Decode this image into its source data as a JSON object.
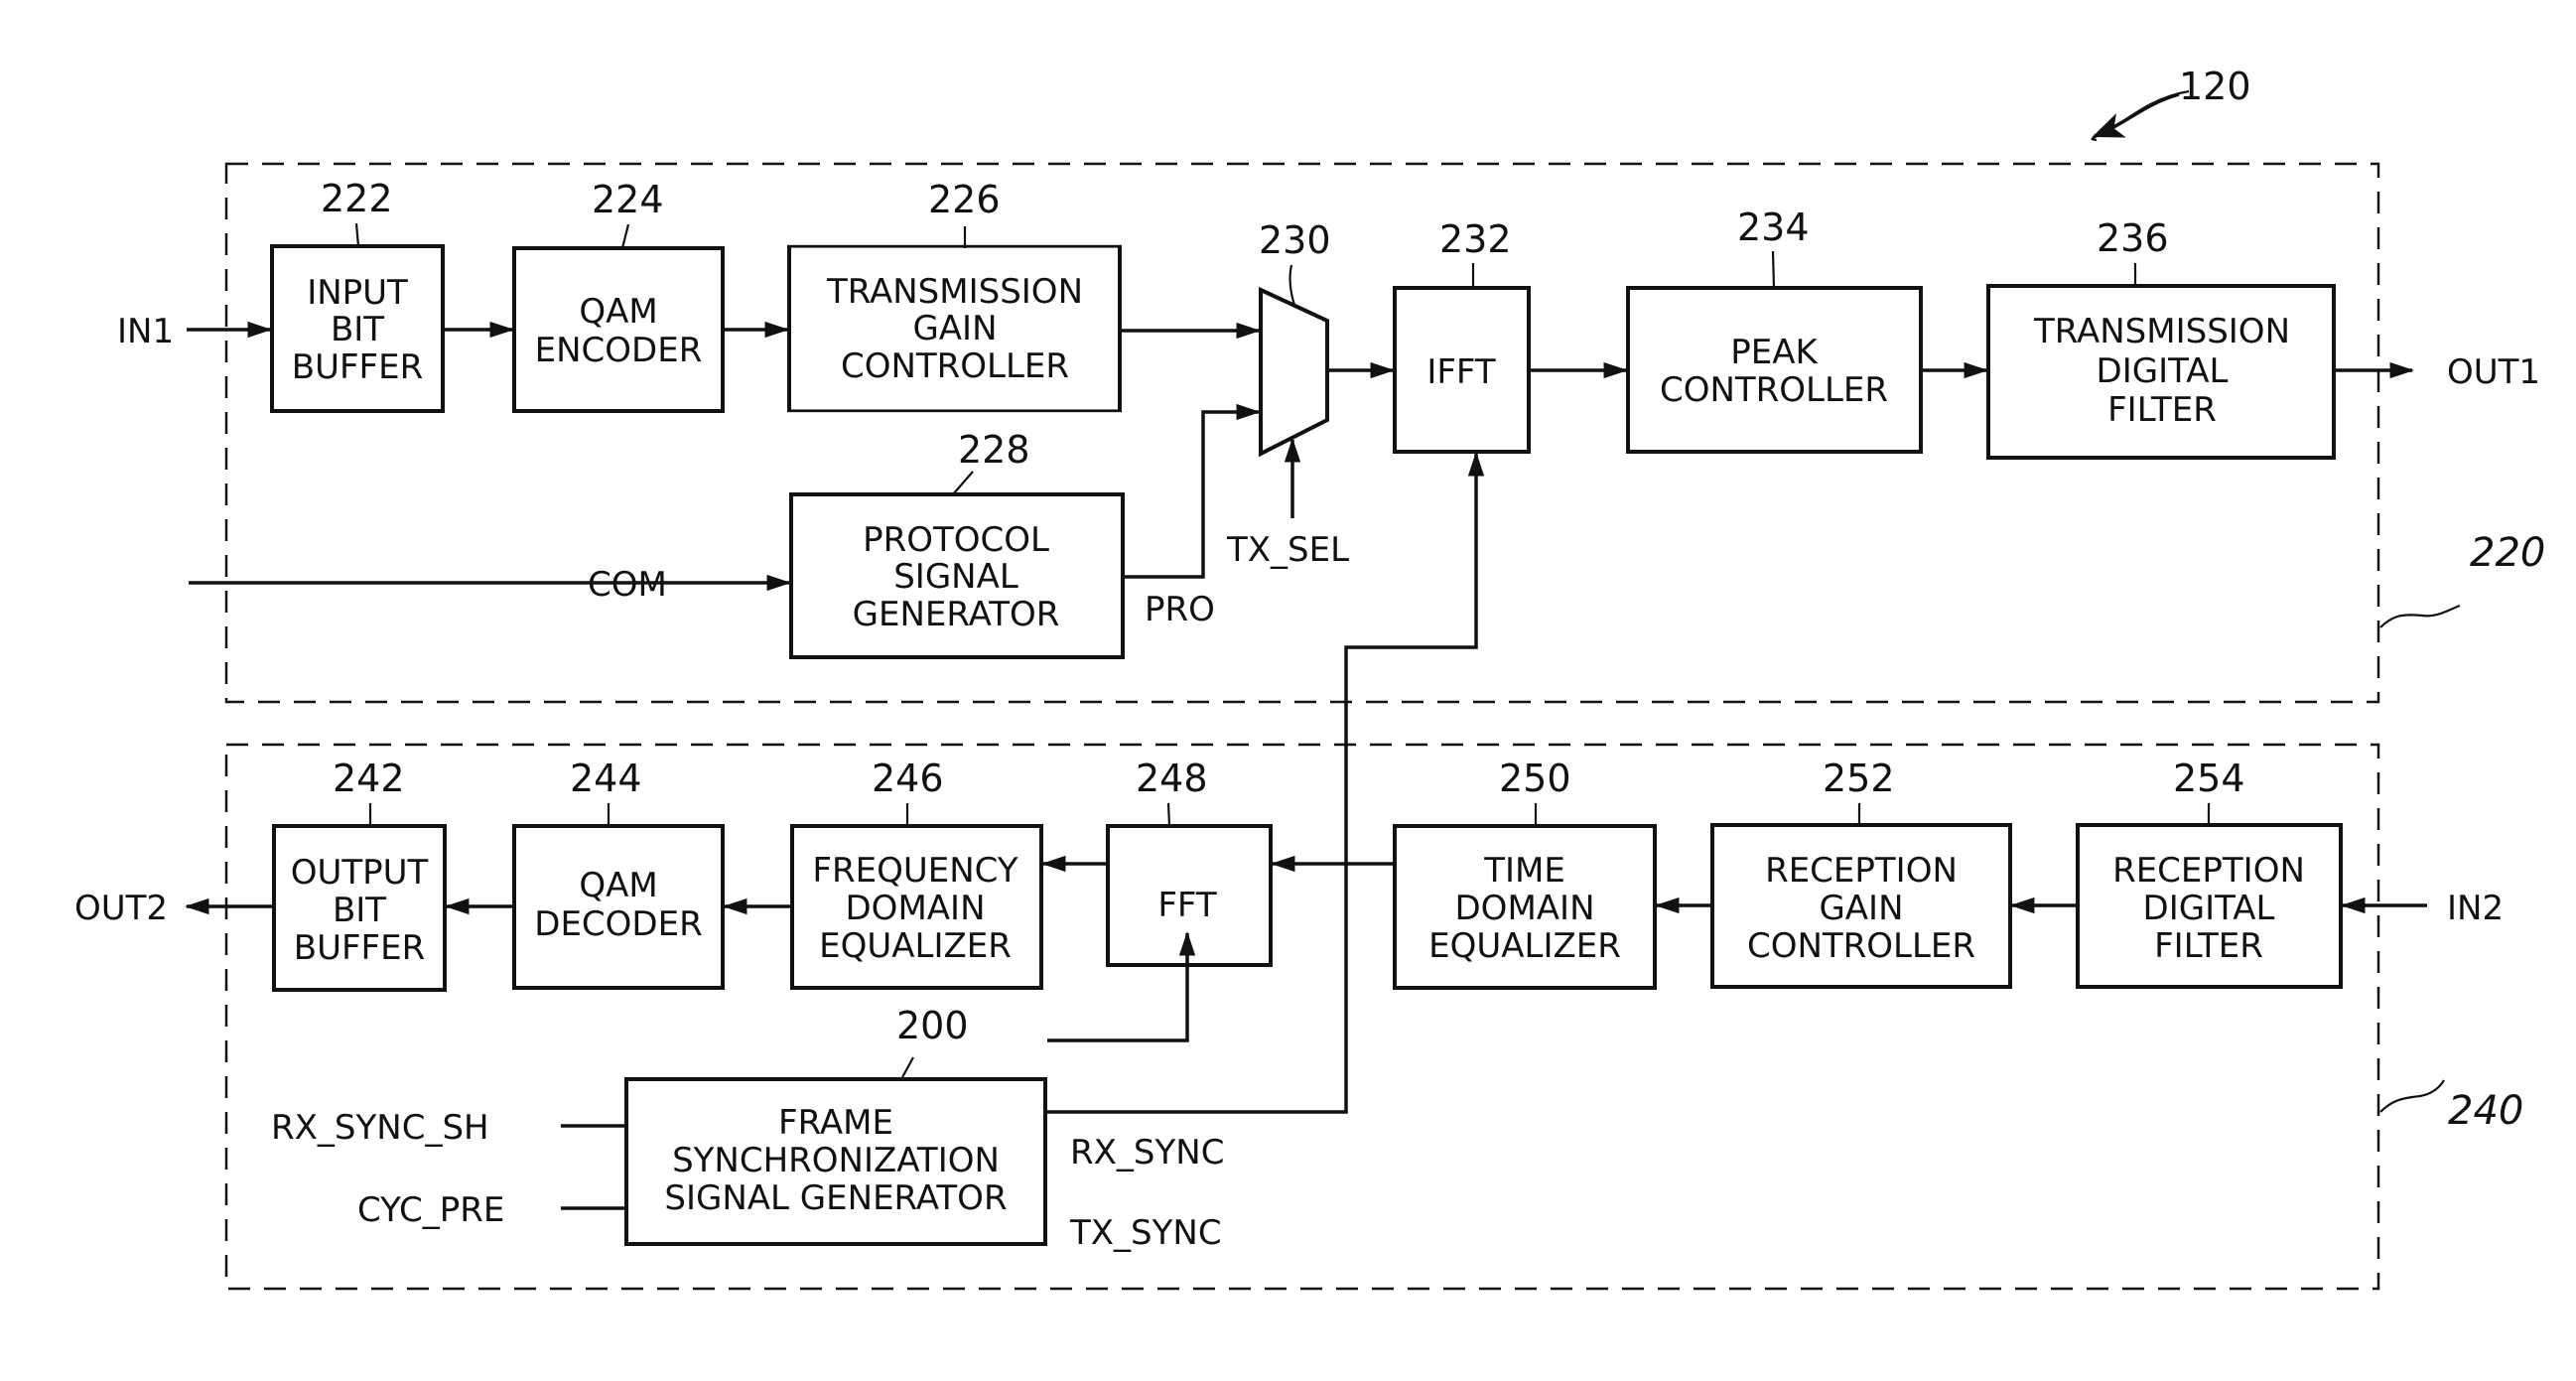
{
  "figure": {
    "ref": "120",
    "tx_section_ref": "220",
    "rx_section_ref": "240"
  },
  "tx_blocks": [
    {
      "id": "input-bit-buffer",
      "ref": "222",
      "lines": [
        "INPUT",
        "BIT",
        "BUFFER"
      ]
    },
    {
      "id": "qam-encoder",
      "ref": "224",
      "lines": [
        "QAM",
        "ENCODER"
      ]
    },
    {
      "id": "transmission-gain-controller",
      "ref": "226",
      "lines": [
        "TRANSMISSION",
        "GAIN",
        "CONTROLLER"
      ]
    },
    {
      "id": "protocol-signal-generator",
      "ref": "228",
      "lines": [
        "PROTOCOL",
        "SIGNAL",
        "GENERATOR"
      ]
    },
    {
      "id": "multiplexer",
      "ref": "230",
      "lines": []
    },
    {
      "id": "ifft",
      "ref": "232",
      "lines": [
        "IFFT"
      ]
    },
    {
      "id": "peak-controller",
      "ref": "234",
      "lines": [
        "PEAK",
        "CONTROLLER"
      ]
    },
    {
      "id": "transmission-digital-filter",
      "ref": "236",
      "lines": [
        "TRANSMISSION",
        "DIGITAL",
        "FILTER"
      ]
    }
  ],
  "rx_blocks": [
    {
      "id": "output-bit-buffer",
      "ref": "242",
      "lines": [
        "OUTPUT",
        "BIT",
        "BUFFER"
      ]
    },
    {
      "id": "qam-decoder",
      "ref": "244",
      "lines": [
        "QAM",
        "DECODER"
      ]
    },
    {
      "id": "frequency-domain-equalizer",
      "ref": "246",
      "lines": [
        "FREQUENCY",
        "DOMAIN",
        "EQUALIZER"
      ]
    },
    {
      "id": "fft",
      "ref": "248",
      "lines": [
        "FFT"
      ]
    },
    {
      "id": "time-domain-equalizer",
      "ref": "250",
      "lines": [
        "TIME",
        "DOMAIN",
        "EQUALIZER"
      ]
    },
    {
      "id": "reception-gain-controller",
      "ref": "252",
      "lines": [
        "RECEPTION",
        "GAIN",
        "CONTROLLER"
      ]
    },
    {
      "id": "reception-digital-filter",
      "ref": "254",
      "lines": [
        "RECEPTION",
        "DIGITAL",
        "FILTER"
      ]
    },
    {
      "id": "frame-synchronization-signal-generator",
      "ref": "200",
      "lines": [
        "FRAME",
        "SYNCHRONIZATION",
        "SIGNAL GENERATOR"
      ]
    }
  ],
  "signals": {
    "in1": "IN1",
    "out1": "OUT1",
    "com": "COM",
    "pro": "PRO",
    "tx_sel": "TX_SEL",
    "out2": "OUT2",
    "in2": "IN2",
    "rx_sync_sh": "RX_SYNC_SH",
    "cyc_pre": "CYC_PRE",
    "rx_sync": "RX_SYNC",
    "tx_sync": "TX_SYNC"
  }
}
